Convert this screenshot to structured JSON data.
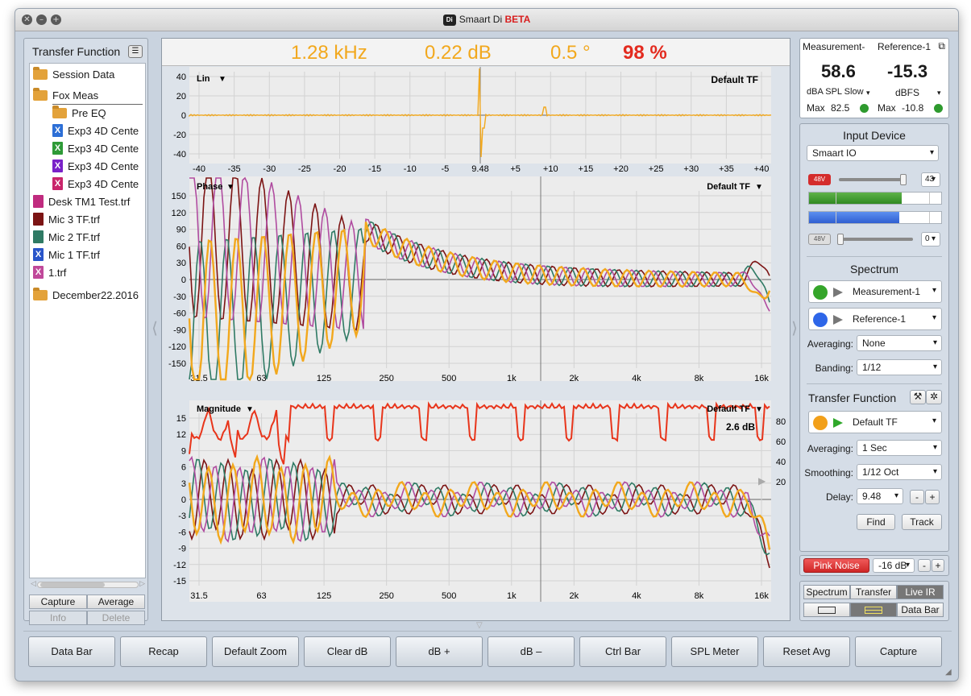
{
  "window": {
    "title_prefix": "Smaart Di ",
    "title_beta": "BETA",
    "logo_text": "Di"
  },
  "left_panel": {
    "title": "Transfer Function",
    "tree": [
      {
        "label": "Session Data",
        "type": "folder",
        "level": 0
      },
      {
        "label": "Fox Meas",
        "type": "folder",
        "level": 0
      },
      {
        "label": "Pre EQ",
        "type": "folder",
        "level": 1
      },
      {
        "label": "Exp3 4D Cente",
        "type": "file-x",
        "level": 1,
        "color": "#2d6fd6"
      },
      {
        "label": "Exp3 4D Cente",
        "type": "file-x",
        "level": 1,
        "color": "#2e9a37"
      },
      {
        "label": "Exp3 4D Cente",
        "type": "file-x",
        "level": 1,
        "color": "#7a22c8"
      },
      {
        "label": "Exp3 4D Cente",
        "type": "file-x",
        "level": 1,
        "color": "#c9266b"
      },
      {
        "label": "Desk TM1 Test.trf",
        "type": "file",
        "level": 0,
        "color": "#c02b7f"
      },
      {
        "label": "Mic 3 TF.trf",
        "type": "file",
        "level": 0,
        "color": "#7c1414"
      },
      {
        "label": "Mic 2 TF.trf",
        "type": "file",
        "level": 0,
        "color": "#2f7a64"
      },
      {
        "label": "Mic 1 TF.trf",
        "type": "file-x",
        "level": 0,
        "color": "#2a55c9"
      },
      {
        "label": "1.trf",
        "type": "file-x",
        "level": 0,
        "color": "#c0489a"
      },
      {
        "label": "December22.2016",
        "type": "folder",
        "level": 0
      }
    ],
    "buttons": {
      "capture": "Capture",
      "average": "Average",
      "info": "Info",
      "delete": "Delete"
    }
  },
  "readout": {
    "freq": "1.28 kHz",
    "db": "0.22 dB",
    "phase": "0.5 °",
    "coherence": "98 %",
    "colors": {
      "freq": "#f2a81d",
      "coherence": "#e32b1f"
    }
  },
  "plots": {
    "ir": {
      "label": "Lin",
      "tag": "Default TF",
      "y_ticks": [
        "40",
        "20",
        "0",
        "-20",
        "-40"
      ],
      "x_ticks": [
        "-40",
        "-35",
        "-30",
        "-25",
        "-20",
        "-15",
        "-10",
        "-5",
        "9.48",
        "+5",
        "+10",
        "+15",
        "+20",
        "+25",
        "+30",
        "+35",
        "+40"
      ]
    },
    "phase": {
      "label": "Phase",
      "tag": "Default TF",
      "y_ticks": [
        "150",
        "120",
        "90",
        "60",
        "30",
        "0",
        "-30",
        "-60",
        "-90",
        "-120",
        "-150"
      ],
      "x_ticks": [
        "31.5",
        "63",
        "125",
        "250",
        "500",
        "1k",
        "2k",
        "4k",
        "8k",
        "16k"
      ]
    },
    "magnitude": {
      "label": "Magnitude",
      "tag": "Default TF",
      "offset": "2.6 dB",
      "y_ticks": [
        "15",
        "12",
        "9",
        "6",
        "3",
        "0",
        "-3",
        "-6",
        "-9",
        "-12",
        "-15"
      ],
      "coh_ticks": [
        "80",
        "60",
        "40",
        "20"
      ],
      "x_ticks": [
        "31.5",
        "63",
        "125",
        "250",
        "500",
        "1k",
        "2k",
        "4k",
        "8k",
        "16k"
      ]
    }
  },
  "meas": {
    "col1_head": "Measurement-",
    "col2_head": "Reference-1",
    "val1": "58.6",
    "val2": "-15.3",
    "unit1": "dBA SPL Slow",
    "unit2": "dBFS",
    "max_label": "Max",
    "max1": "82.5",
    "max2": "-10.8"
  },
  "input": {
    "title": "Input Device",
    "device": "Smaart IO",
    "phantom": "48V",
    "gain1": "43",
    "gain2": "0",
    "meter1_level": 0.7,
    "meter2_level": 0.68
  },
  "spectrum": {
    "title": "Spectrum",
    "source1": "Measurement-1",
    "source2": "Reference-1",
    "averaging_label": "Averaging:",
    "averaging": "None",
    "banding_label": "Banding:",
    "banding": "1/12"
  },
  "tf": {
    "title": "Transfer Function",
    "source": "Default TF",
    "averaging_label": "Averaging:",
    "averaging": "1 Sec",
    "smoothing_label": "Smoothing:",
    "smoothing": "1/12 Oct",
    "delay_label": "Delay:",
    "delay": "9.48",
    "minus": "-",
    "plus": "+",
    "find": "Find",
    "track": "Track"
  },
  "generator": {
    "label": "Pink Noise",
    "level": "-16 dB",
    "minus": "-",
    "plus": "+"
  },
  "modes": {
    "spectrum": "Spectrum",
    "transfer": "Transfer",
    "live_ir": "Live IR",
    "data_bar": "Data Bar"
  },
  "toolbar": [
    "Data Bar",
    "Recap",
    "Default Zoom",
    "Clear dB",
    "dB +",
    "dB –",
    "Ctrl Bar",
    "SPL Meter",
    "Reset Avg",
    "Capture"
  ]
}
